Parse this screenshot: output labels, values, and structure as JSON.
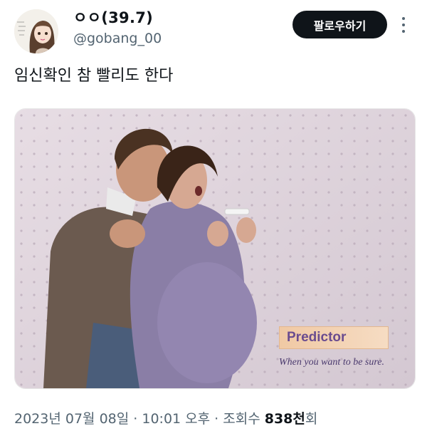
{
  "author": {
    "display_name": "ㅇㅇ(39.7)",
    "handle": "@gobang_00"
  },
  "follow_button": {
    "label": "팔로우하기"
  },
  "tweet": {
    "text": "임신확인 참 빨리도 한다"
  },
  "media": {
    "ad_brand": "Predictor",
    "ad_tagline": "When you want to be sure."
  },
  "meta": {
    "date": "2023년 07월 08일",
    "separator1": " · ",
    "time": "10:01 오후",
    "separator2": " · ",
    "views_label": "조회수 ",
    "views_count": "838천",
    "views_suffix": "회"
  },
  "icons": {
    "more": "more-vertical-icon",
    "avatar": "anime-girl-avatar"
  },
  "colors": {
    "text_primary": "#0f1419",
    "text_secondary": "#536471",
    "follow_bg": "#0f1419"
  }
}
